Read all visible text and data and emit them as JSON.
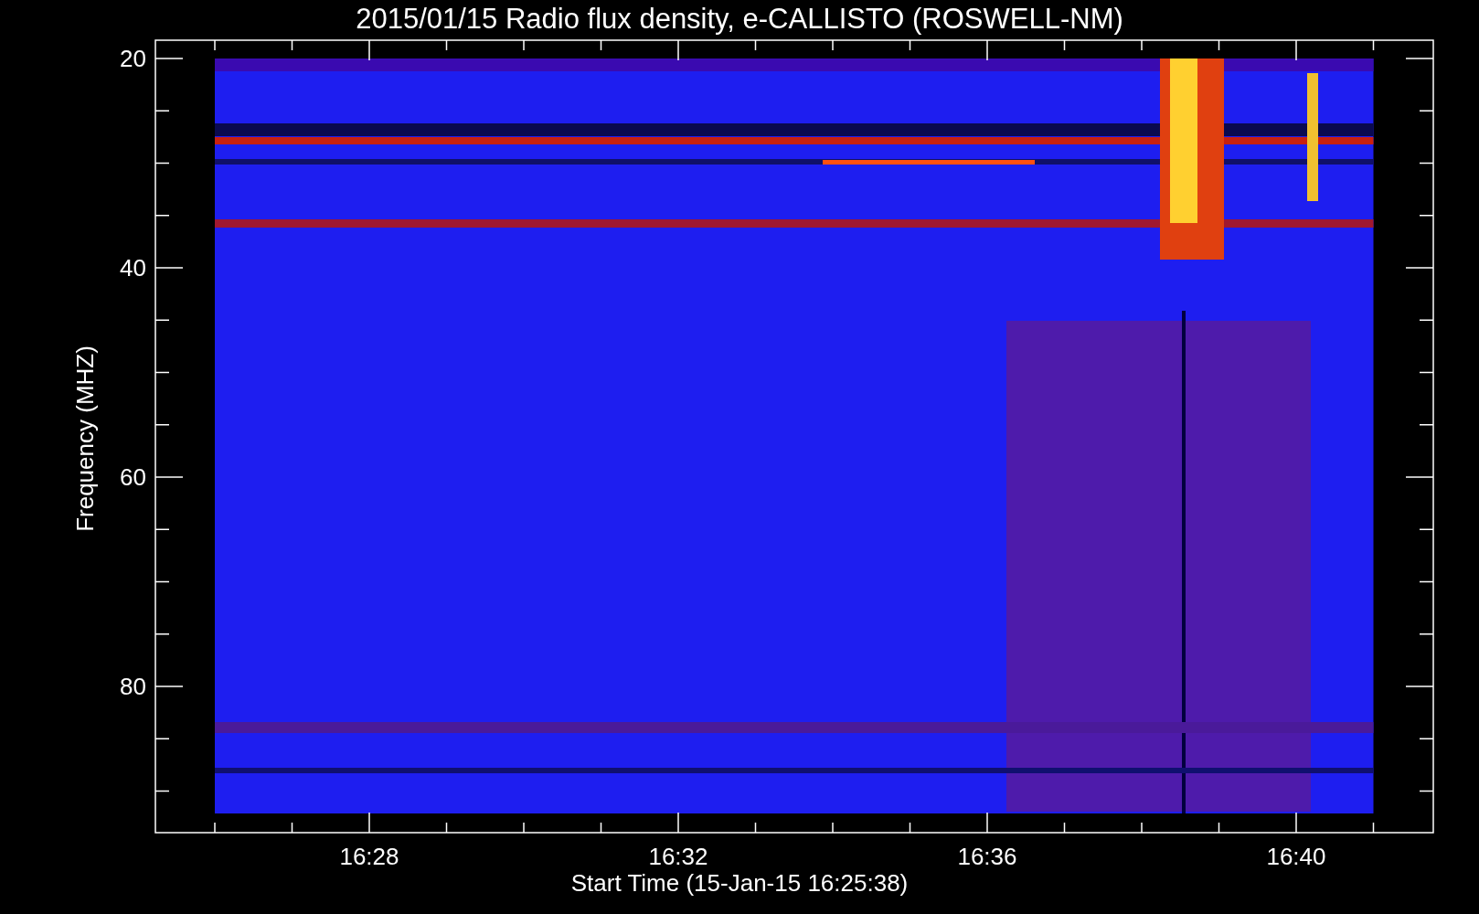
{
  "title": "2015/01/15  Radio flux density, e-CALLISTO (ROSWELL-NM)",
  "y_axis": {
    "label": "Frequency (MHZ)",
    "tick_labels": [
      "20",
      "40",
      "60",
      "80"
    ]
  },
  "x_axis": {
    "label": "Start Time (15-Jan-15 16:25:38)",
    "tick_labels": [
      "16:28",
      "16:32",
      "16:36",
      "16:40"
    ]
  }
}
